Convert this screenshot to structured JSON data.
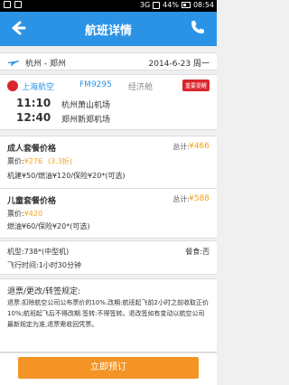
{
  "status_bar": {
    "network": "3G",
    "battery": "44%",
    "time": "08:54"
  },
  "header": {
    "title": "航班详情"
  },
  "route": {
    "cities": "杭州 - 郑州",
    "date": "2014-6-23 周一"
  },
  "flight": {
    "airline": "上海航空",
    "flight_no": "FM9295",
    "cabin": "经济舱",
    "badge": "重要提醒",
    "dep_time": "11:10",
    "arr_time": "12:40",
    "dep_airport": "杭州萧山机场",
    "arr_airport": "郑州新郑机场"
  },
  "adult": {
    "title": "成人套餐价格",
    "total_label": "总计:",
    "total": "¥466",
    "fare_label": "票价:",
    "fare": "¥276",
    "discount": "(3.3折)",
    "taxes": "机建¥50/燃油¥120/保险¥20*(可选)"
  },
  "child": {
    "title": "儿童套餐价格",
    "total_label": "总计:",
    "total": "¥588",
    "fare_label": "票价:",
    "fare": "¥420",
    "taxes": "燃油¥60/保险¥20*(可选)"
  },
  "misc": {
    "aircraft": "机型:738*(中型机)",
    "meal": "餐食:否",
    "duration": "飞行时间:1小时30分钟"
  },
  "rules": {
    "title": "退票/更改/转签规定:",
    "text": "退票:扣除航空公司公布票价的10%.改期:航班起飞前2小时之前收取正价10%;航班起飞后不得改期.签转:不得签转。退改签如有变动以航空公司最新规定为准,退票需收回凭票。"
  },
  "footer": {
    "book_label": "立即预订"
  },
  "colors": {
    "primary": "#2a93e6",
    "accent": "#f39424",
    "price": "#f5a21a",
    "badge": "#d9262c"
  }
}
